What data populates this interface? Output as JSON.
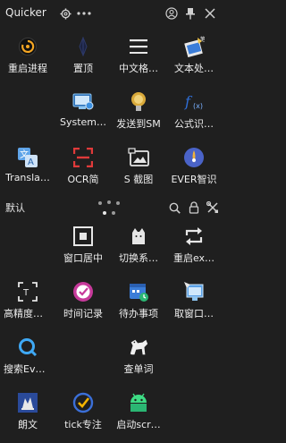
{
  "titlebar": {
    "title": "Quicker",
    "icons": [
      "settings-icon",
      "more-icon",
      "account-icon",
      "pin-icon",
      "close-icon"
    ]
  },
  "page_indicator": {
    "total_pages": 5,
    "active_page": 1
  },
  "top_grid": [
    {
      "label": "重启进程",
      "icon": "restart-process-icon"
    },
    {
      "label": "置顶",
      "icon": "pin-on-top-icon"
    },
    {
      "label": "中文格…",
      "icon": "menu-lines-icon"
    },
    {
      "label": "文本处…",
      "icon": "text-process-icon"
    },
    {
      "label": "",
      "icon": ""
    },
    {
      "label": "System…",
      "icon": "system-monitor-icon"
    },
    {
      "label": "发送到SM",
      "icon": "send-to-sm-icon"
    },
    {
      "label": "公式识…",
      "icon": "formula-icon"
    },
    {
      "label": "Transla…",
      "icon": "translate-icon"
    },
    {
      "label": "OCR简",
      "icon": "ocr-icon"
    },
    {
      "label": "S 截图",
      "icon": "screenshot-icon"
    },
    {
      "label": "EVER智识",
      "icon": "ever-icon"
    }
  ],
  "section": {
    "label": "默认",
    "icons": [
      "search-icon",
      "lock-icon",
      "tools-icon"
    ]
  },
  "bottom_grid": [
    {
      "label": "",
      "icon": ""
    },
    {
      "label": "窗口居中",
      "icon": "window-center-icon"
    },
    {
      "label": "切换系…",
      "icon": "switch-system-icon"
    },
    {
      "label": "重启ex…",
      "icon": "restart-explorer-icon"
    },
    {
      "label": "高精度…",
      "icon": "high-precision-icon"
    },
    {
      "label": "时间记录",
      "icon": "time-record-icon"
    },
    {
      "label": "待办事项",
      "icon": "todo-icon"
    },
    {
      "label": "取窗口…",
      "icon": "get-window-icon"
    },
    {
      "label": "搜索Ev…",
      "icon": "search-everything-icon"
    },
    {
      "label": "",
      "icon": ""
    },
    {
      "label": "查单词",
      "icon": "dictionary-icon"
    },
    {
      "label": "",
      "icon": ""
    },
    {
      "label": "朗文",
      "icon": "longman-icon"
    },
    {
      "label": "tick专注",
      "icon": "tick-focus-icon"
    },
    {
      "label": "启动scr…",
      "icon": "launch-scrcpy-icon"
    },
    {
      "label": "",
      "icon": ""
    }
  ]
}
